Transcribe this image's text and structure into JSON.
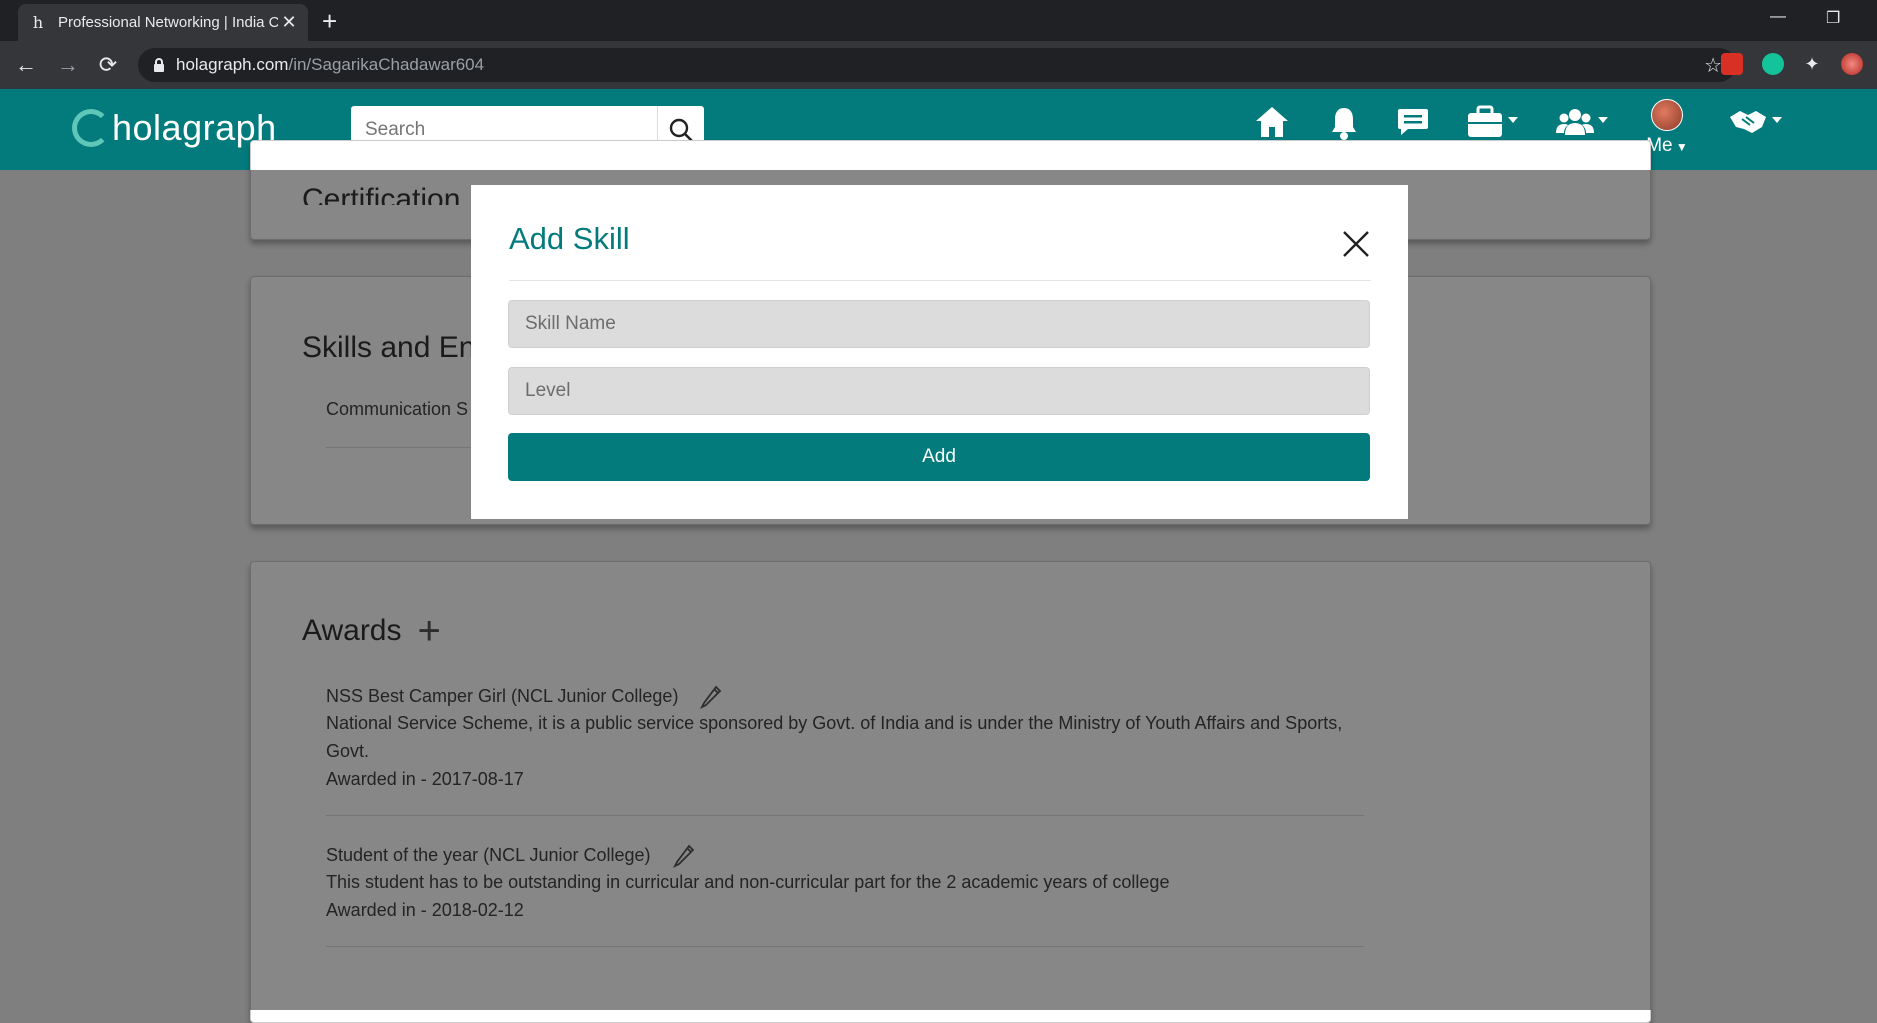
{
  "browser": {
    "tab_title": "Professional Networking | India C",
    "tab_favicon": "h",
    "url_domain": "holagraph.com",
    "url_path": "/in/SagarikaChadawar604"
  },
  "header": {
    "logo_text": "holagraph",
    "search_placeholder": "Search",
    "me_label": "Me",
    "brand_color": "#037b7c"
  },
  "page": {
    "certification_heading": "Certification",
    "skills_heading": "Skills and En",
    "skills_item": "Communication S",
    "awards_heading": "Awards",
    "awards": [
      {
        "title": "NSS Best Camper Girl (NCL Junior College)",
        "description": "National Service Scheme, it is a public service sponsored by Govt. of India and is under the Ministry of Youth Affairs and Sports, Govt.",
        "date": "Awarded in - 2017-08-17"
      },
      {
        "title": "Student of the year (NCL Junior College)",
        "description": "This student has to be outstanding in curricular and non-curricular part for the 2 academic years of college",
        "date": "Awarded in - 2018-02-12"
      }
    ]
  },
  "modal": {
    "title": "Add Skill",
    "skill_name_placeholder": "Skill Name",
    "level_placeholder": "Level",
    "add_label": "Add"
  }
}
